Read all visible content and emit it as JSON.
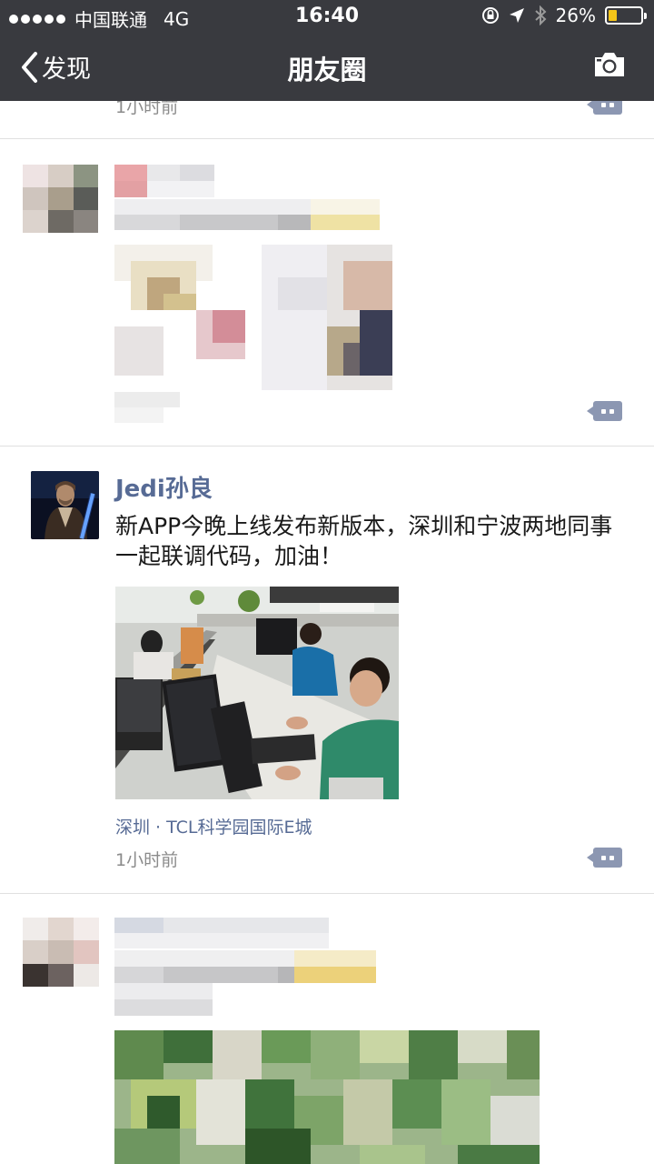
{
  "status_bar": {
    "carrier": "中国联通",
    "network": "4G",
    "time": "16:40",
    "battery": "26%",
    "battery_level": 0.26
  },
  "nav": {
    "back_label": "发现",
    "title": "朋友圈",
    "camera_icon": "camera-icon"
  },
  "feed": {
    "top_partial_time": "1小时前",
    "post": {
      "username": "Jedi孙良",
      "content": "新APP今晚上线发布新版本，深圳和宁波两地同事一起联调代码，加油！",
      "location": "深圳 · TCL科学园国际E城",
      "time": "1小时前"
    }
  },
  "colors": {
    "nav_bg": "#393a3f",
    "name_blue": "#576b95",
    "comment_button": "#8c97b2",
    "battery_fill": "#f5c518"
  }
}
